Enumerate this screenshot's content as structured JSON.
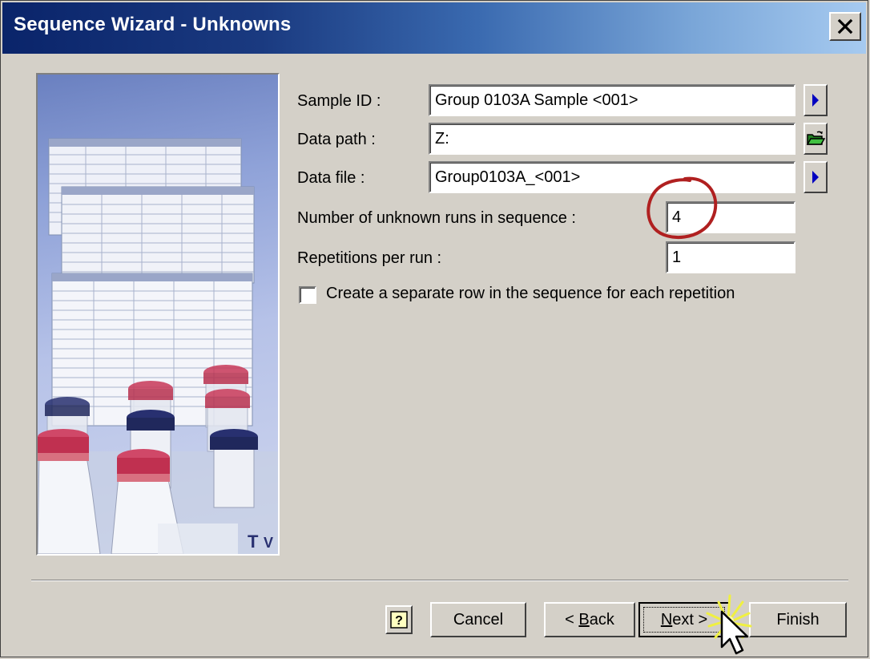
{
  "window": {
    "title": "Sequence Wizard - Unknowns"
  },
  "form": {
    "sample_id": {
      "label": "Sample ID :",
      "value": "Group 0103A Sample <001>"
    },
    "data_path": {
      "label": "Data path :",
      "value": "Z:"
    },
    "data_file": {
      "label": "Data file :",
      "value": "Group0103A_<001>"
    },
    "unknown_runs": {
      "label": "Number of unknown runs in sequence :",
      "value": "4"
    },
    "repetitions": {
      "label": "Repetitions per run :",
      "value": "1"
    },
    "separate_rows": {
      "label": "Create a separate row in the sequence for each repetition",
      "checked": false
    }
  },
  "buttons": {
    "help": "?",
    "cancel": "Cancel",
    "back_prefix": "< ",
    "back_key": "B",
    "back_rest": "ack",
    "next_key": "N",
    "next_rest": "ext >",
    "finish": "Finish"
  },
  "icons": {
    "close": "close-icon",
    "arrow": "arrow-right-icon",
    "folder": "open-folder-icon",
    "help": "help-icon",
    "cursor": "mouse-cursor-icon"
  },
  "colors": {
    "titlebar_start": "#0a246a",
    "titlebar_end": "#a6caf0",
    "face": "#d4d0c8",
    "highlight_circle": "#b02020",
    "click_burst": "#f0f040"
  }
}
